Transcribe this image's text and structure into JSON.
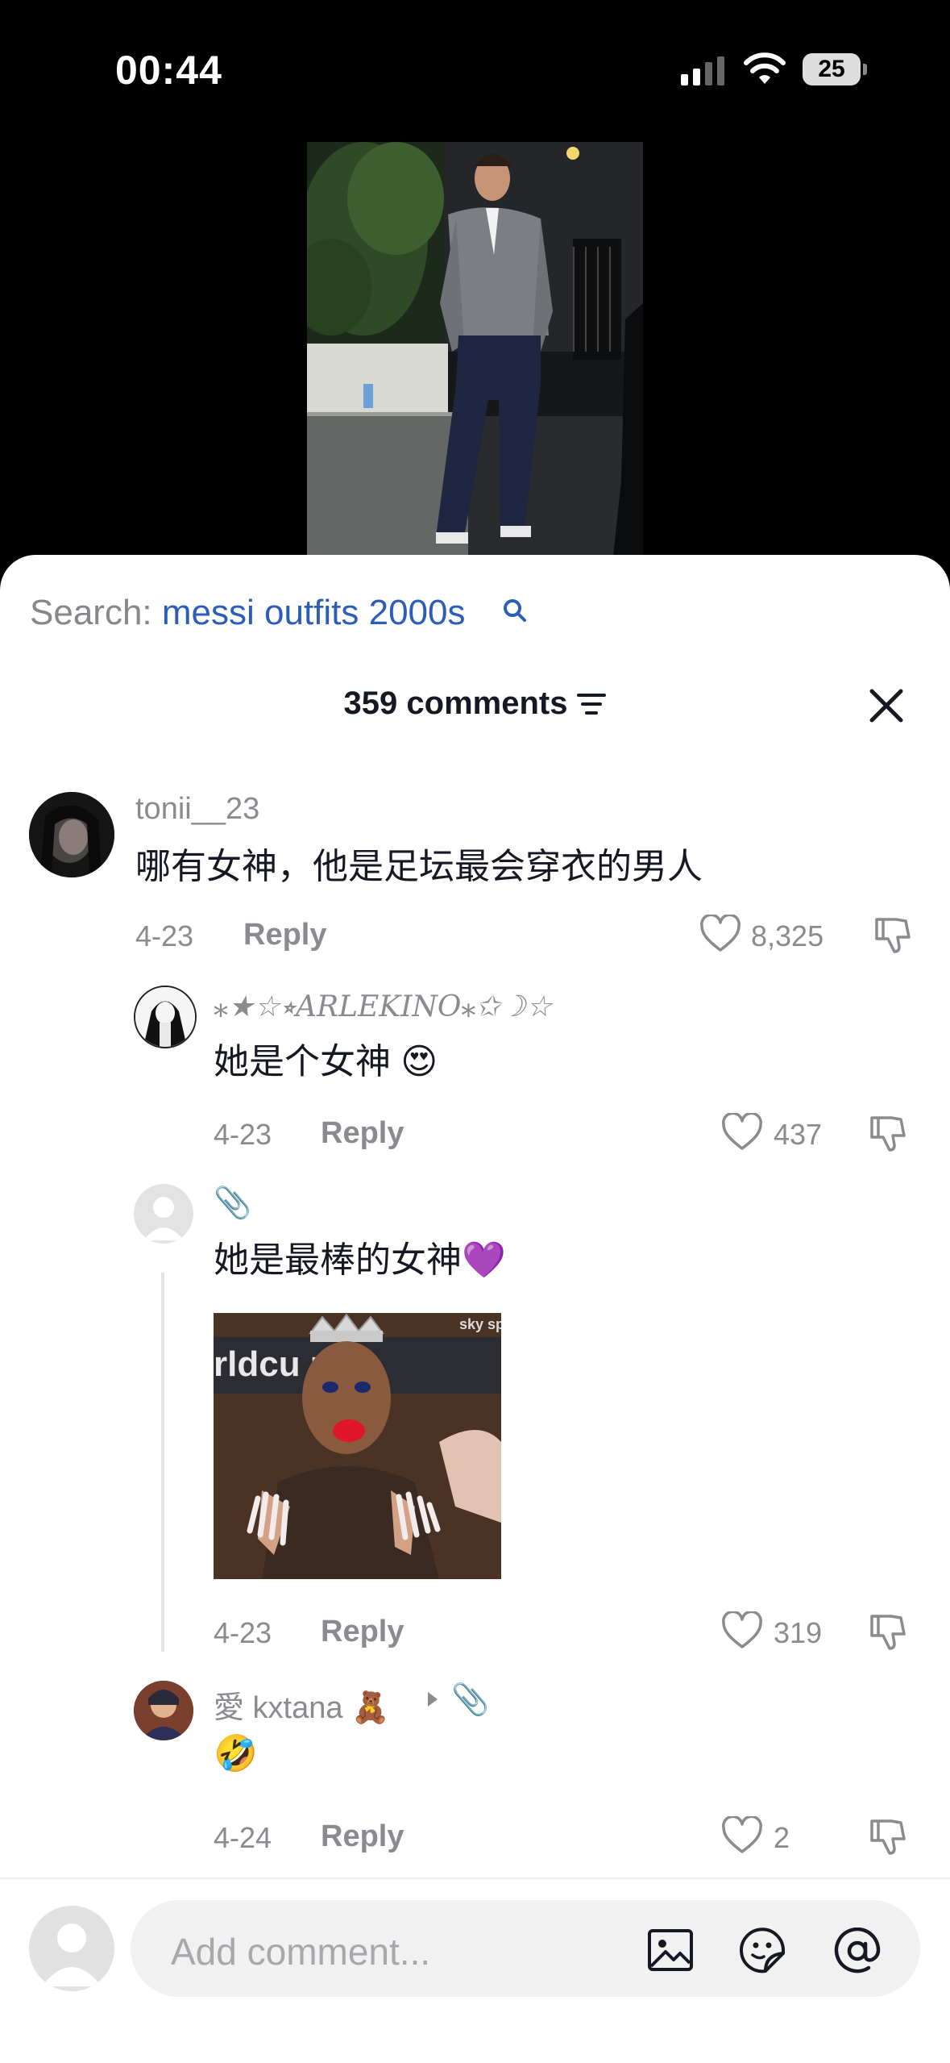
{
  "status_bar": {
    "time": "00:44",
    "battery": "25",
    "signal_icon": "signal-icon",
    "wifi_icon": "wifi-icon"
  },
  "search": {
    "label": "Search:",
    "query": "messi outfits 2000s",
    "icon": "search-icon"
  },
  "comments_header": {
    "count": "359 comments",
    "sort_icon": "sort-icon",
    "close_icon": "close-icon"
  },
  "comments": [
    {
      "username": "tonii__23",
      "text": "哪有女神，他是足坛最会穿衣的男人",
      "date": "4-23",
      "reply": "Reply",
      "likes": "8,325"
    },
    {
      "username": "⁎★☆⭒ARLEKINO⁎✩☽☆",
      "text": "她是个女神 😍",
      "date": "4-23",
      "reply": "Reply",
      "likes": "437"
    },
    {
      "username": "📎",
      "text": "她是最棒的女神💜",
      "date": "4-23",
      "reply": "Reply",
      "likes": "319",
      "has_gif": true
    },
    {
      "username": "愛 kxtana 🧸",
      "reply_to": "📎",
      "text": "🤣",
      "date": "4-24",
      "reply": "Reply",
      "likes": "2"
    }
  ],
  "gif_text": {
    "brand": "sky sp",
    "banner": "rldcu m"
  },
  "composer": {
    "placeholder": "Add comment...",
    "icons": [
      "image-icon",
      "sticker-icon",
      "mention-icon"
    ]
  },
  "colors": {
    "accent_link": "#2b5db9",
    "muted": "#8a8b91",
    "text": "#161823"
  }
}
